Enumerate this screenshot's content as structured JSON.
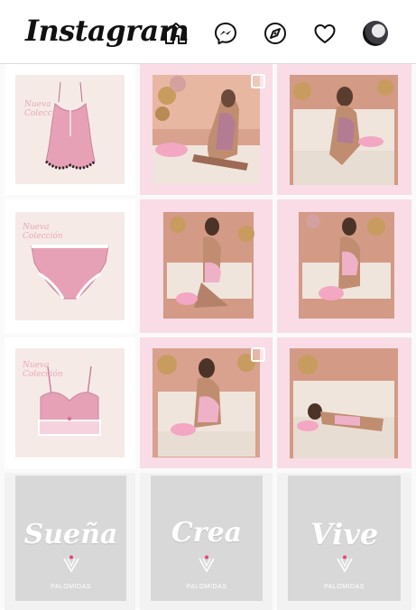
{
  "app": {
    "logo": "Instagram"
  },
  "nav": {
    "icons": [
      "home-icon",
      "messenger-icon",
      "explore-icon",
      "activity-heart-icon",
      "profile-avatar"
    ]
  },
  "colors": {
    "tile_pink": "#f9dce6",
    "product_bg": "#f6eae7",
    "gray_card": "#d8d8d8",
    "lingerie_pink": "#e7a1b7"
  },
  "products": {
    "script_line_1": "Nueva",
    "script_line_2": "Colección"
  },
  "brand_cards": [
    {
      "word": "Sueña",
      "sub": "PALOMIDAS"
    },
    {
      "word": "Crea",
      "sub": "PALOMIDAS"
    },
    {
      "word": "Vive",
      "sub": "PALOMIDAS"
    }
  ]
}
